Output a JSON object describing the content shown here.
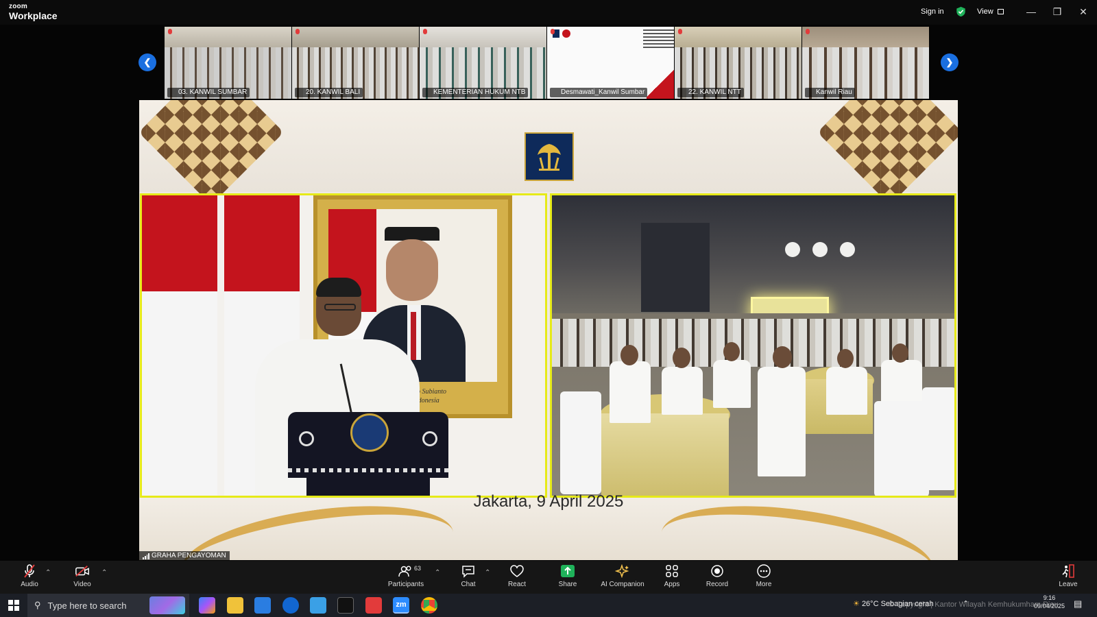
{
  "app": {
    "brand_top": "zoom",
    "brand_bottom": "Workplace",
    "sign_in": "Sign in",
    "view": "View"
  },
  "thumbnails": [
    {
      "label": "03. KANWIL SUMBAR"
    },
    {
      "label": "20. KANWIL BALI"
    },
    {
      "label": "KEMENTERIAN HUKUM NTB"
    },
    {
      "label": "Desmawati_Kanwil Sumbar"
    },
    {
      "label": "22. KANWIL NTT"
    },
    {
      "label": "Kanwil Riau"
    }
  ],
  "stage": {
    "place_date": "Jakarta, 9 April 2025",
    "portrait_caption": "... M. Prabowo Subianto\nRepublik Indonesia",
    "source_label": "GRAHA PENGAYOMAN"
  },
  "toolbar": {
    "audio": "Audio",
    "video": "Video",
    "participants": "Participants",
    "participants_count": "63",
    "chat": "Chat",
    "react": "React",
    "share": "Share",
    "ai_companion": "AI Companion",
    "apps": "Apps",
    "record": "Record",
    "more": "More",
    "leave": "Leave"
  },
  "taskbar": {
    "search_placeholder": "Type here to search",
    "weather": "26°C  Sebagian cerah",
    "time": "9:16",
    "date": "09/04/2025",
    "watermark": "© Copyright | Kantor Wilayah Kemhukumham Riau"
  },
  "colors": {
    "accent": "#1a6fe0",
    "active_speaker": "#e6ea18",
    "share_green": "#1fb25a",
    "muted_red": "#e23b3b",
    "leave_red": "#e23b3b"
  }
}
